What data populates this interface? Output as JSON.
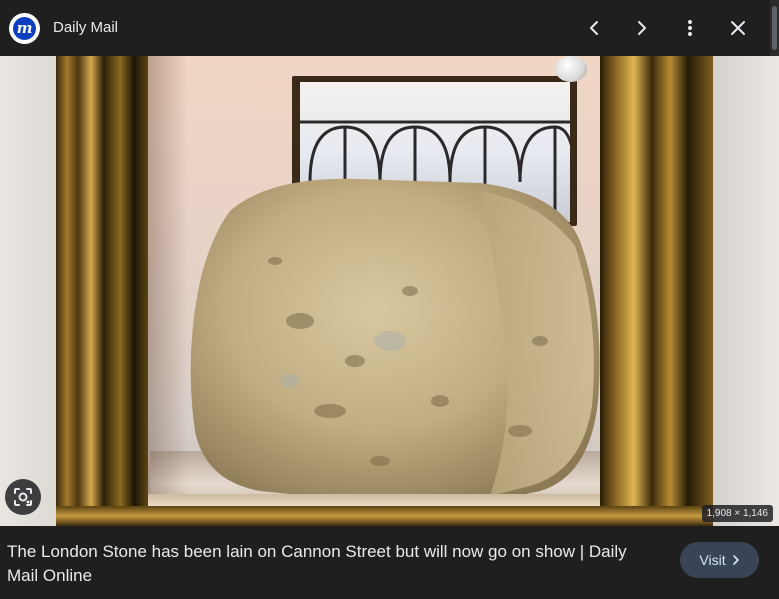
{
  "header": {
    "source_logo_letter": "m",
    "source_name": "Daily Mail",
    "prev_icon": "chevron-left-icon",
    "next_icon": "chevron-right-icon",
    "more_icon": "more-vert-icon",
    "close_icon": "close-icon"
  },
  "image": {
    "dimensions_label": "1,908 × 1,146",
    "lens_icon": "lens-search-icon"
  },
  "caption": {
    "title": "The London Stone has been lain on Cannon Street but will now go on show | Daily Mail Online"
  },
  "visit": {
    "label": "Visit",
    "icon": "chevron-right-icon"
  },
  "colors": {
    "background": "#1f1f1f",
    "text": "#e8eaed",
    "visit_bg": "#394457",
    "visit_text": "#d3e3fd",
    "logo_blue": "#0c3fbf"
  }
}
